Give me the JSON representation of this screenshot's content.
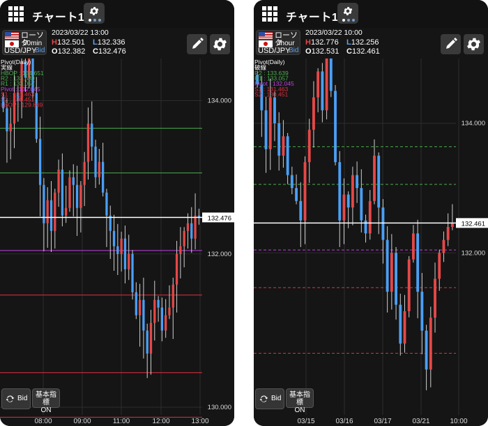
{
  "panels": [
    {
      "title": "チャート1",
      "chart_type_label": "ローソク",
      "interval": "60min",
      "pair": "USD/JPY",
      "side": "Bid",
      "datetime": "2023/03/22 13:00",
      "ohlc": {
        "h_label": "H",
        "h": "132.501",
        "l_label": "L",
        "l": "132.336",
        "o_label": "O",
        "o": "132.382",
        "c_label": "C",
        "c": "132.476"
      },
      "indicator": {
        "title": "Pivot(Daily)",
        "mode": "実線",
        "lines": [
          {
            "label": "HBOP : 134.651",
            "value": 134.651,
            "color": "#4caf50"
          },
          {
            "label": "R2 : 133.639",
            "value": 133.639,
            "color": "#4caf50"
          },
          {
            "label": "R1 : 133.057",
            "value": 133.057,
            "color": "#4caf50"
          },
          {
            "label": "Pivot : 132.045",
            "value": 132.045,
            "color": "#c040e0"
          },
          {
            "label": "S1 : 131.463",
            "value": 131.463,
            "color": "#e03040"
          },
          {
            "label": "S2 : 130.451",
            "value": 130.451,
            "color": "#e03040"
          },
          {
            "label": "LBOP : 129.869",
            "value": 129.869,
            "color": "#e03040"
          }
        ]
      },
      "price_ticks": [
        "134.000",
        "132.000",
        "130.000"
      ],
      "current_price": "132.476",
      "time_ticks": [
        "08:00",
        "09:00",
        "11:00",
        "12:00",
        "13:00"
      ],
      "buttons": {
        "bid": "Bid",
        "indicator_line1": "基本指標",
        "indicator_line2": "ON"
      },
      "chart_data": {
        "type": "candlestick",
        "ylim": [
          129.9,
          134.55
        ],
        "current": 132.476,
        "line_style": "solid",
        "closes": [
          133.9,
          133.6,
          133.7,
          134.1,
          134.0,
          134.5,
          134.3,
          134.7,
          134.1,
          133.5,
          132.9,
          132.4,
          132.7,
          132.3,
          132.8,
          133.1,
          132.5,
          132.6,
          133.0,
          132.9,
          132.6,
          132.9,
          133.2,
          133.7,
          133.4,
          133.0,
          133.2,
          132.8,
          132.5,
          132.3,
          132.1,
          132.0,
          132.2,
          131.8,
          132.0,
          131.5,
          131.2,
          131.4,
          131.0,
          130.7,
          131.1,
          131.4,
          131.3,
          131.0,
          131.2,
          131.3,
          131.6,
          132.0,
          132.1,
          132.3,
          132.4,
          132.2,
          132.5,
          132.476
        ],
        "colors": {
          "up": "#e54848",
          "down": "#4a9ff5"
        }
      }
    },
    {
      "title": "チャート1",
      "chart_type_label": "ローソク",
      "interval": "4hour",
      "pair": "USD/JPY",
      "side": "Bid",
      "datetime": "2023/03/22 10:00",
      "ohlc": {
        "h_label": "H",
        "h": "132.776",
        "l_label": "L",
        "l": "132.256",
        "o_label": "O",
        "o": "132.531",
        "c_label": "C",
        "c": "132.461"
      },
      "indicator": {
        "title": "Pivot(Daily)",
        "mode": "破線",
        "lines": [
          {
            "label": "R2 : 133.639",
            "value": 133.639,
            "color": "#4caf50"
          },
          {
            "label": "R1 : 133.057",
            "value": 133.057,
            "color": "#4caf50"
          },
          {
            "label": "Pivot : 132.045",
            "value": 132.045,
            "color": "#c040e0"
          },
          {
            "label": "S1 : 131.463",
            "value": 131.463,
            "color": "#e03040"
          },
          {
            "label": "S2 : 130.451",
            "value": 130.451,
            "color": "#e03040"
          }
        ]
      },
      "price_ticks": [
        "134.000",
        "132.000"
      ],
      "current_price": "132.461",
      "time_ticks": [
        "03/15",
        "03/16",
        "03/17",
        "03/21",
        "10:00"
      ],
      "buttons": {
        "bid": "Bid",
        "indicator_line1": "基本指標",
        "indicator_line2": "ON"
      },
      "chart_data": {
        "type": "candlestick",
        "ylim": [
          129.5,
          135.0
        ],
        "current": 132.461,
        "line_style": "dashed",
        "closes": [
          134.6,
          134.2,
          133.6,
          134.4,
          134.0,
          133.5,
          133.8,
          133.2,
          133.0,
          132.8,
          132.5,
          133.4,
          133.9,
          134.4,
          134.8,
          134.2,
          135.0,
          134.5,
          133.4,
          132.5,
          132.9,
          132.7,
          133.2,
          133.0,
          132.5,
          132.3,
          132.8,
          133.5,
          132.7,
          132.2,
          131.4,
          132.0,
          131.2,
          130.6,
          131.1,
          131.9,
          132.3,
          131.4,
          130.8,
          130.2,
          131.0,
          131.6,
          132.0,
          132.2,
          132.4,
          132.461
        ],
        "colors": {
          "up": "#e54848",
          "down": "#4a9ff5"
        }
      }
    }
  ]
}
